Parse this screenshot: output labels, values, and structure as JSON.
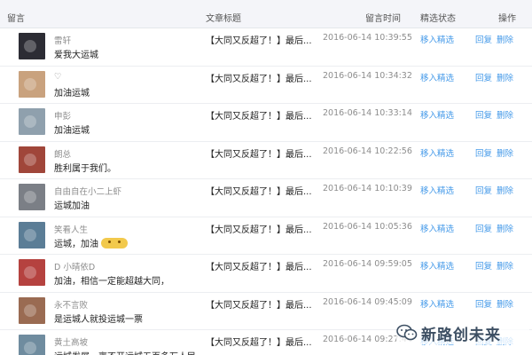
{
  "header": {
    "message": "留言",
    "article_title": "文章标题",
    "time": "留言时间",
    "status": "精选状态",
    "operation": "操作"
  },
  "actions": {
    "move": "移入精选",
    "reply": "回复",
    "delete": "删除"
  },
  "rows": [
    {
      "nickname": "雷轩",
      "content": "爱我大运城",
      "title": "【大同又反超了！】最后...",
      "time": "2016-06-14 10:39:55",
      "avatar_color": "#2c2c34"
    },
    {
      "nickname": "♡",
      "content": "加油运城",
      "title": "【大同又反超了！】最后...",
      "time": "2016-06-14 10:34:32",
      "avatar_color": "#c9a27e"
    },
    {
      "nickname": "申彭",
      "content": "加油运城",
      "title": "【大同又反超了！】最后...",
      "time": "2016-06-14 10:33:14",
      "avatar_color": "#8fa0ad"
    },
    {
      "nickname": "朗总",
      "content": "胜利属于我们。",
      "title": "【大同又反超了！】最后...",
      "time": "2016-06-14 10:22:56",
      "avatar_color": "#a0463a"
    },
    {
      "nickname": "自由自在小二上虾",
      "content": "运城加油",
      "title": "【大同又反超了！】最后...",
      "time": "2016-06-14 10:10:39",
      "avatar_color": "#7b7f86"
    },
    {
      "nickname": "笑看人生",
      "content": "运城，加油",
      "emoji": true,
      "title": "【大同又反超了！】最后...",
      "time": "2016-06-14 10:05:36",
      "avatar_color": "#5b7d96"
    },
    {
      "nickname": "D 小晴依D",
      "content": "加油，相信一定能超越大同，",
      "title": "【大同又反超了！】最后...",
      "time": "2016-06-14 09:59:05",
      "avatar_color": "#b5423f"
    },
    {
      "nickname": "永不言败",
      "content": "是运城人就投运城一票",
      "title": "【大同又反超了！】最后...",
      "time": "2016-06-14 09:45:09",
      "avatar_color": "#9a6b52"
    },
    {
      "nickname": "黄土高坡",
      "content": "运城发展，离不开运城五百多万人民",
      "title": "【大同又反超了！】最后...",
      "time": "2016-06-14 09:27:44",
      "avatar_color": "#6f8c9f"
    }
  ],
  "watermark": {
    "text": "新路创未来"
  }
}
